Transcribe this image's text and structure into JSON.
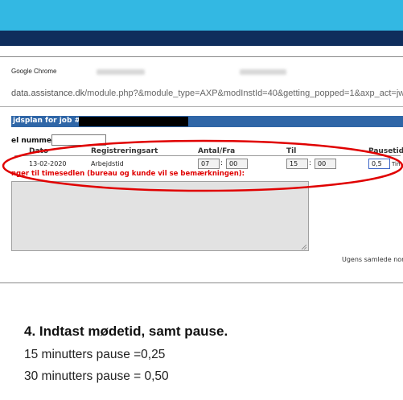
{
  "browser": {
    "window_title": "Google Chrome",
    "url_host": "data.assistance.dk",
    "url_path": "/module.php?&module_type=AXP&modInstId=40&getting_popped=1&axp_act=jweek"
  },
  "panel": {
    "title": "jdsplan for job #"
  },
  "form": {
    "tel_label": "el nummer",
    "tel_value": "",
    "columns": {
      "date": "Dato",
      "type": "Registreringsart",
      "from": "Antal/Fra",
      "to": "Til",
      "pause": "Pausetid"
    },
    "row": {
      "date": "13-02-2020",
      "type": "Arbejdstid",
      "from_hour": "07",
      "from_min": "00",
      "to_hour": "15",
      "to_min": "00",
      "pause": "0,5",
      "pause_unit": "Tim"
    },
    "remark_label": "nger til timesedlen (bureau og kunde vil se bemærkningen):",
    "remark_value": "",
    "week_total_label": "Ugens samlede nor"
  },
  "instructions": {
    "heading": "4. Indtast mødetid, samt pause.",
    "line1": "15 minutters pause =0,25",
    "line2": "30 minutters pause = 0,50"
  },
  "colors": {
    "top_bar": "#33b8e3",
    "nav_bar": "#0f2d5c",
    "panel_title_bar": "#2f66a7",
    "remark_label": "#e00000",
    "highlight_ellipse": "#e00000"
  }
}
